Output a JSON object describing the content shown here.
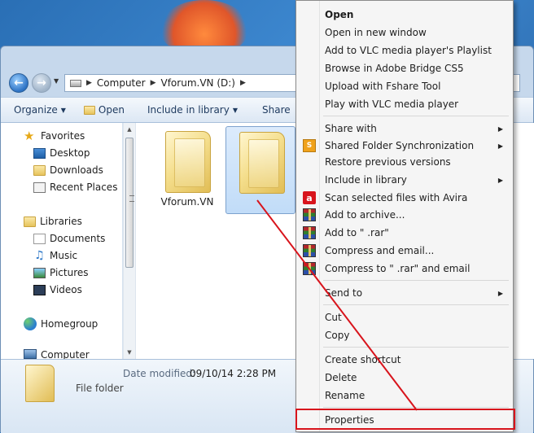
{
  "explorer": {
    "breadcrumb": [
      "Computer",
      "Vforum.VN (D:)"
    ],
    "toolbar": {
      "organize": "Organize",
      "open": "Open",
      "include_in_library": "Include in library",
      "share": "Share"
    },
    "nav_pane": {
      "favorites": "Favorites",
      "desktop": "Desktop",
      "downloads": "Downloads",
      "recent_places": "Recent Places",
      "libraries": "Libraries",
      "documents": "Documents",
      "music": "Music",
      "pictures": "Pictures",
      "videos": "Videos",
      "homegroup": "Homegroup",
      "computer": "Computer"
    },
    "folders": [
      {
        "name": "Vforum.VN",
        "selected": false
      },
      {
        "name": "",
        "selected": true
      }
    ],
    "details": {
      "date_label": "Date modified:",
      "date_value": "09/10/14 2:28 PM",
      "type": "File folder"
    }
  },
  "context_menu": {
    "items": [
      {
        "label": "Open",
        "bold": true
      },
      {
        "label": "Open in new window"
      },
      {
        "label": "Add to VLC media player's Playlist"
      },
      {
        "label": "Browse in Adobe Bridge CS5"
      },
      {
        "label": "Upload with Fshare Tool"
      },
      {
        "label": "Play with VLC media player"
      },
      {
        "label": "Share with",
        "submenu": true
      },
      {
        "label": "Shared Folder Synchronization",
        "submenu": true,
        "icon": "sync-icon"
      },
      {
        "label": "Restore previous versions"
      },
      {
        "label": "Include in library",
        "submenu": true
      },
      {
        "label": "Scan selected files with Avira",
        "icon": "avira-icon"
      },
      {
        "label": "Add to archive...",
        "icon": "winrar-icon"
      },
      {
        "label": "Add to \" .rar\"",
        "icon": "winrar-icon"
      },
      {
        "label": "Compress and email...",
        "icon": "winrar-icon"
      },
      {
        "label": "Compress to \" .rar\" and email",
        "icon": "winrar-icon"
      },
      {
        "label": "Send to",
        "submenu": true
      },
      {
        "label": "Cut"
      },
      {
        "label": "Copy"
      },
      {
        "label": "Create shortcut"
      },
      {
        "label": "Delete"
      },
      {
        "label": "Rename"
      },
      {
        "label": "Properties",
        "highlighted": true
      }
    ]
  },
  "colors": {
    "highlight_box": "#d8141c",
    "annotation_line": "#d8141c"
  }
}
